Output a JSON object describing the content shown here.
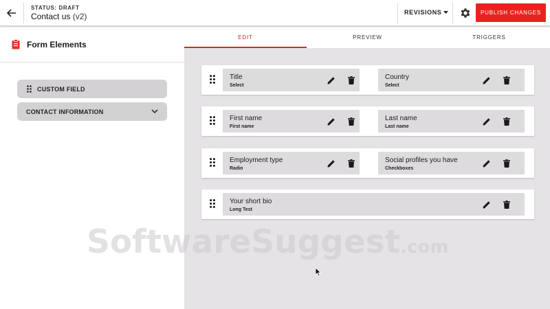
{
  "header": {
    "status": "STATUS: DRAFT",
    "title": "Contact us",
    "version": "(v2)",
    "revisions_label": "REVISIONS",
    "publish_label": "PUBLISH CHANGES"
  },
  "sidebar": {
    "title": "Form Elements",
    "items": [
      {
        "label": "CUSTOM FIELD"
      },
      {
        "label": "CONTACT INFORMATION"
      }
    ]
  },
  "tabs": [
    {
      "label": "EDIT",
      "active": true
    },
    {
      "label": "PREVIEW",
      "active": false
    },
    {
      "label": "TRIGGERS",
      "active": false
    }
  ],
  "rows": [
    {
      "fields": [
        {
          "name": "Title",
          "type": "Select"
        },
        {
          "name": "Country",
          "type": "Select"
        }
      ]
    },
    {
      "fields": [
        {
          "name": "First name",
          "type": "First name"
        },
        {
          "name": "Last name",
          "type": "Last name"
        }
      ]
    },
    {
      "fields": [
        {
          "name": "Employment type",
          "type": "Radio"
        },
        {
          "name": "Social profiles you have",
          "type": "Checkboxes"
        }
      ]
    },
    {
      "fields": [
        {
          "name": "Your short bio",
          "type": "Long Test"
        }
      ]
    }
  ],
  "watermark": {
    "text": "SoftwareSuggest",
    "suffix": ".com"
  },
  "colors": {
    "accent": "#e8231f",
    "active_tab": "#d42a22",
    "field_bg": "#dedbde",
    "canvas_bg": "#e6e3e6"
  },
  "icons": [
    "back-arrow-icon",
    "gear-icon",
    "clipboard-icon",
    "drag-handle-icon",
    "chevron-down-icon",
    "pencil-icon",
    "trash-icon"
  ]
}
